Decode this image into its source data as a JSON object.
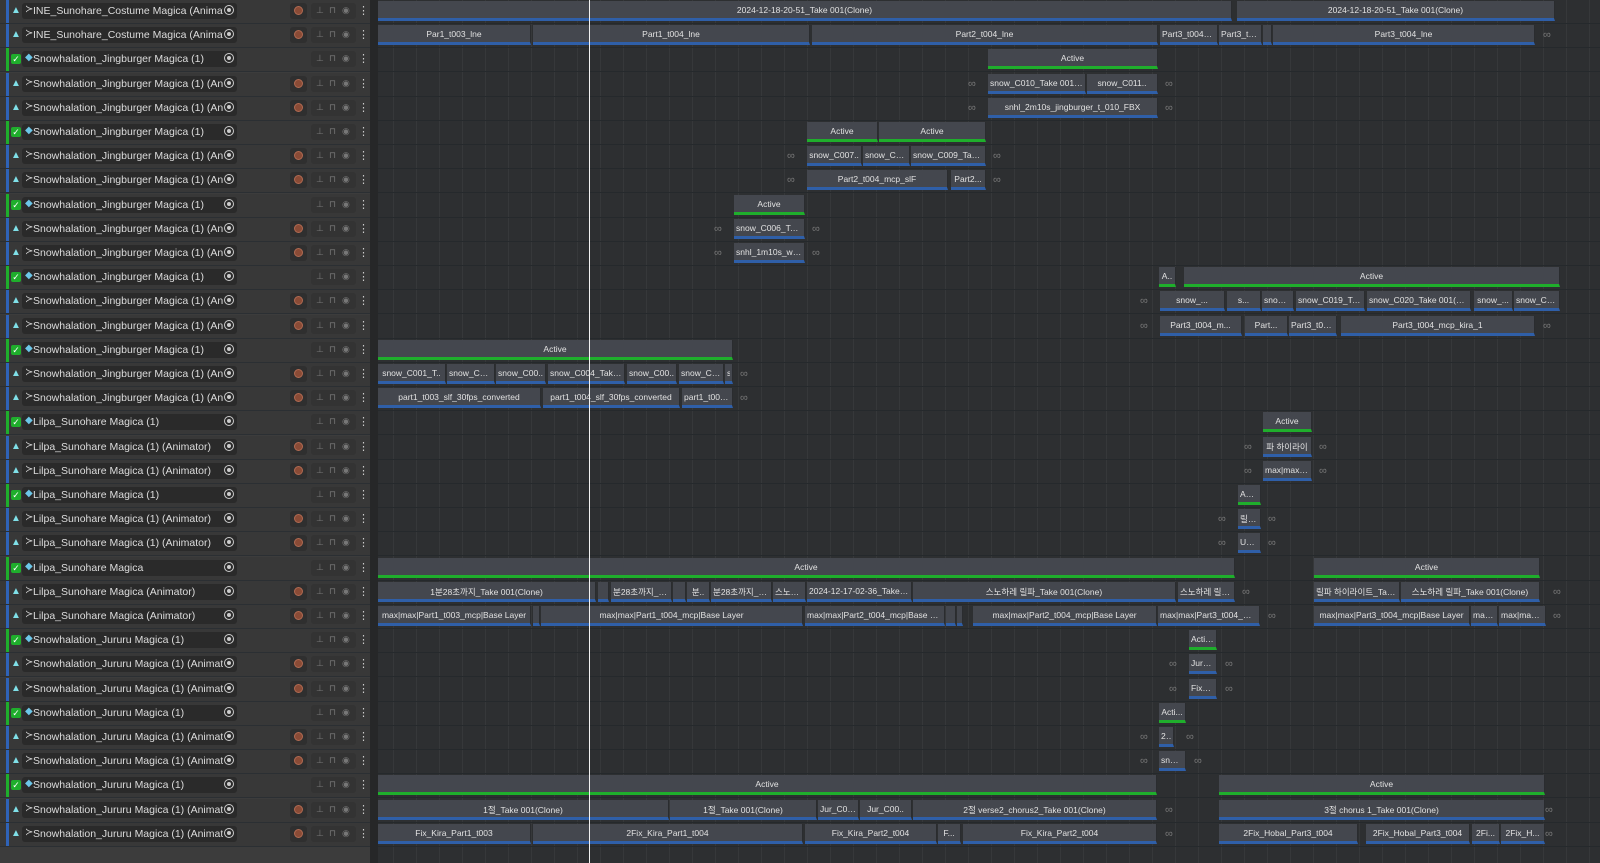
{
  "playhead_label": "",
  "tracks": [
    {
      "name": "INE_Sunohare_Costume Magica (Animator)",
      "type": "anim",
      "clips": [
        "2024-12-18-20-51_Take 001(Clone)",
        "2024-12-18-20-51_Take 001(Clone)"
      ]
    },
    {
      "name": "INE_Sunohare_Costume Magica (Animator)",
      "type": "anim",
      "clips": [
        "Par1_t003_lne",
        "Part1_t004_lne",
        "Part2_t004_lne",
        "Part3_t004_l...",
        "Part3_t0...",
        "",
        "Part3_t004_lne"
      ]
    },
    {
      "name": "Snowhalation_Jingburger Magica (1)",
      "type": "grp",
      "clips": [
        "Active"
      ]
    },
    {
      "name": "Snowhalation_Jingburger Magica (1) (Animato",
      "type": "anim",
      "clips": [
        "snow_C010_Take 001(Cl...",
        "snow_C011.."
      ]
    },
    {
      "name": "Snowhalation_Jingburger Magica (1) (Animato",
      "type": "anim",
      "clips": [
        "snhl_2m10s_jingburger_t_010_FBX"
      ]
    },
    {
      "name": "Snowhalation_Jingburger Magica (1)",
      "type": "grp",
      "clips": [
        "Active",
        "Active"
      ]
    },
    {
      "name": "Snowhalation_Jingburger Magica (1) (Animato",
      "type": "anim",
      "clips": [
        "snow_C007..",
        "snow_C00..",
        "snow_C009_Take .."
      ]
    },
    {
      "name": "Snowhalation_Jingburger Magica (1) (Animato",
      "type": "anim",
      "clips": [
        "Part2_t004_mcp_slF",
        "Part2..."
      ]
    },
    {
      "name": "Snowhalation_Jingburger Magica (1)",
      "type": "grp",
      "clips": [
        "Active"
      ]
    },
    {
      "name": "Snowhalation_Jingburger Magica (1) (Animato",
      "type": "anim",
      "clips": [
        "snow_C006_Take.."
      ]
    },
    {
      "name": "Snowhalation_Jingburger Magica (1) (Animato",
      "type": "anim",
      "clips": [
        "snhl_1m10s_wide..."
      ]
    },
    {
      "name": "Snowhalation_Jingburger Magica (1)",
      "type": "grp",
      "clips": [
        "A..",
        "Active"
      ]
    },
    {
      "name": "Snowhalation_Jingburger Magica (1) (Animato",
      "type": "anim",
      "clips": [
        "snow_...",
        "s...",
        "snow_...",
        "snow_C019_Ta...",
        "snow_C020_Take 001(Clo...",
        "snow_...",
        "snow_C021_Tak..."
      ]
    },
    {
      "name": "Snowhalation_Jingburger Magica (1) (Animato",
      "type": "anim",
      "clips": [
        "Part3_t004_m...",
        "Part...",
        "Part3_t00...",
        "Part3_t004_mcp_kira_1"
      ]
    },
    {
      "name": "Snowhalation_Jingburger Magica (1)",
      "type": "grp",
      "clips": [
        "Active"
      ]
    },
    {
      "name": "Snowhalation_Jingburger Magica (1) (Animato",
      "type": "anim",
      "clips": [
        "snow_C001_T..",
        "snow_C00..",
        "snow_C00..",
        "snow_C004_Take ...",
        "snow_C00..",
        "snow_C0..",
        "s.."
      ]
    },
    {
      "name": "Snowhalation_Jingburger Magica (1) (Animato",
      "type": "anim",
      "clips": [
        "part1_t003_slf_30fps_converted",
        "part1_t004_slf_30fps_converted",
        "part1_t004_slf..."
      ]
    },
    {
      "name": "Lilpa_Sunohare Magica (1)",
      "type": "grp",
      "clips": [
        "Active"
      ]
    },
    {
      "name": "Lilpa_Sunohare Magica (1) (Animator)",
      "type": "anim",
      "clips": [
        "파 하이라이"
      ]
    },
    {
      "name": "Lilpa_Sunohare Magica (1) (Animator)",
      "type": "anim",
      "clips": [
        "max|max|P.."
      ]
    },
    {
      "name": "Lilpa_Sunohare Magica (1)",
      "type": "grp",
      "clips": [
        "Act..."
      ]
    },
    {
      "name": "Lilpa_Sunohare Magica (1) (Animator)",
      "type": "anim",
      "clips": [
        "릴파.."
      ]
    },
    {
      "name": "Lilpa_Sunohare Magica (1) (Animator)",
      "type": "anim",
      "clips": [
        "Unl..."
      ]
    },
    {
      "name": "Lilpa_Sunohare Magica",
      "type": "grp",
      "clips": [
        "Active",
        "Active"
      ]
    },
    {
      "name": "Lilpa_Sunohare Magica (Animator)",
      "type": "anim",
      "clips": [
        "1분28초까지_Take 001(Clone)",
        "",
        "분28초까지_Tak..",
        "",
        "분..",
        "분28초까지_Ta..",
        "스노하레",
        "2024-12-17-02-36_Take 0..",
        "스노하레 릴파_Take 001(Clone)",
        "스노하레 릴파_",
        "릴파 하이라이트_Take 0",
        "스노하레 릴파_Take 001(Clone)"
      ]
    },
    {
      "name": "Lilpa_Sunohare Magica (Animator)",
      "type": "anim",
      "clips": [
        "max|max|Part1_t003_mcp|Base Layer",
        "",
        "max|max|Part1_t004_mcp|Base Layer",
        "max|max|Part2_t004_mcp|Base Lay...",
        "",
        "",
        "max|max|Part2_t004_mcp|Base Layer",
        "max|max|Part3_t004_mcp...",
        "max|max|Part3_t004_mcp|Base Layer",
        "max...",
        "max|max|..."
      ]
    },
    {
      "name": "Snowhalation_Jururu Magica (1)",
      "type": "grp",
      "clips": [
        "Active"
      ]
    },
    {
      "name": "Snowhalation_Jururu Magica (1) (Animator)",
      "type": "anim",
      "clips": [
        "Jur_..."
      ]
    },
    {
      "name": "Snowhalation_Jururu Magica (1) (Animator)",
      "type": "anim",
      "clips": [
        "Fix_K..."
      ]
    },
    {
      "name": "Snowhalation_Jururu Magica (1)",
      "type": "grp",
      "clips": [
        "Acti..."
      ]
    },
    {
      "name": "Snowhalation_Jururu Magica (1) (Animator)",
      "type": "anim",
      "clips": [
        "2..."
      ]
    },
    {
      "name": "Snowhalation_Jururu Magica (1) (Animator)",
      "type": "anim",
      "clips": [
        "snhl..."
      ]
    },
    {
      "name": "Snowhalation_Jururu Magica (1)",
      "type": "grp",
      "clips": [
        "Active",
        "Active"
      ]
    },
    {
      "name": "Snowhalation_Jururu Magica (1) (Animator)",
      "type": "anim",
      "clips": [
        "1절_Take 001(Clone)",
        "1절_Take 001(Clone)",
        "Jur_C00...",
        "Jur_C00..",
        "2절 verse2_chorus2_Take 001(Clone)",
        "3절 chorus 1_Take 001(Clone)"
      ]
    },
    {
      "name": "Snowhalation_Jururu Magica (1) (Animator)",
      "type": "anim",
      "clips": [
        "Fix_Kira_Part1_t003",
        "2Fix_Kira_Part1_t004",
        "Fix_Kira_Part2_t004",
        "F...",
        "Fix_Kira_Part2_t004",
        "2Fix_Hobal_Part3_t004",
        "2Fix_Hobal_Part3_t004",
        "2Fi...",
        "2Fix_H..."
      ]
    }
  ],
  "colors": {
    "active": "#1fae2c",
    "clip_underline": "#2f5fa8",
    "group_bar": "#1fae2c",
    "anim_bar": "#2f63b8"
  }
}
